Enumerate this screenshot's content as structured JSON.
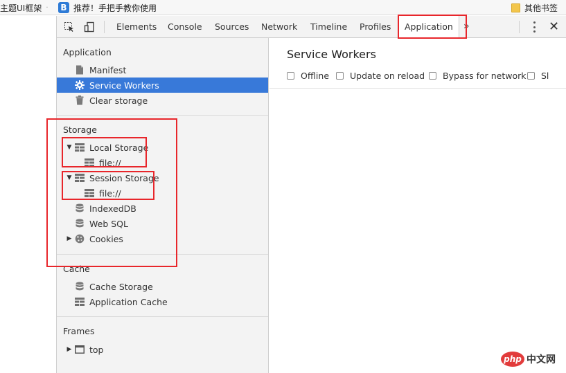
{
  "bookmarks": [
    {
      "label": "主题UI框架",
      "icon": "bookmark-text"
    },
    {
      "label": "推荐！手把手教你使用",
      "icon": "favicon-b"
    },
    {
      "label": "其他书签",
      "icon": "folder-icon"
    }
  ],
  "bookmark_favicon_letter": "B",
  "toolbar": {
    "tabs": [
      "Elements",
      "Console",
      "Sources",
      "Network",
      "Timeline",
      "Profiles",
      "Application"
    ],
    "active_tab": "Application",
    "more_label": "»",
    "close_label": "✕"
  },
  "sidebar": {
    "application": {
      "title": "Application",
      "items": [
        "Manifest",
        "Service Workers",
        "Clear storage"
      ]
    },
    "storage": {
      "title": "Storage",
      "local_storage": "Local Storage",
      "local_child": "file://",
      "session_storage": "Session Storage",
      "session_child": "file://",
      "indexeddb": "IndexedDB",
      "websql": "Web SQL",
      "cookies": "Cookies"
    },
    "cache": {
      "title": "Cache",
      "items": [
        "Cache Storage",
        "Application Cache"
      ]
    },
    "frames": {
      "title": "Frames",
      "top": "top"
    },
    "selected": "Service Workers"
  },
  "main": {
    "title": "Service Workers",
    "options": [
      "Offline",
      "Update on reload",
      "Bypass for network",
      "Sl"
    ]
  },
  "watermark": {
    "logo": "php",
    "text": "中文网"
  },
  "colors": {
    "selected": "#3879d9",
    "annotation": "#e8262b"
  }
}
